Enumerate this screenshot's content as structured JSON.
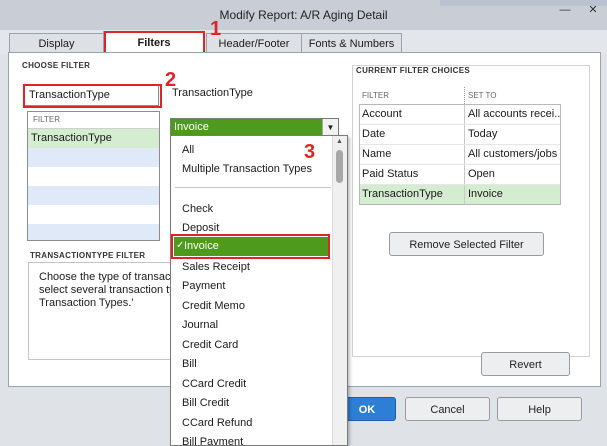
{
  "window": {
    "title": "Modify Report: A/R Aging Detail",
    "controls": {
      "minimize_icon": "minimize-icon",
      "close_icon": "close-icon"
    }
  },
  "tabs": [
    {
      "label": "Display"
    },
    {
      "label": "Filters"
    },
    {
      "label": "Header/Footer"
    },
    {
      "label": "Fonts & Numbers"
    }
  ],
  "callouts": [
    "1",
    "2",
    "3"
  ],
  "choose_filter": {
    "title": "CHOOSE FILTER",
    "search_value": "TransactionType",
    "list_header": "FILTER",
    "list_items": [
      "TransactionType"
    ]
  },
  "filter_detail": {
    "label": "TransactionType",
    "selected": "Invoice",
    "options": [
      "All",
      "Multiple Transaction Types",
      "Check",
      "Deposit",
      "Invoice",
      "Sales Receipt",
      "Payment",
      "Credit Memo",
      "Journal",
      "Credit Card",
      "Bill",
      "CCard Credit",
      "Bill Credit",
      "CCard Refund",
      "Bill Payment"
    ]
  },
  "transactiontype_filter": {
    "title": "TRANSACTIONTYPE FILTER",
    "lines": [
      "Choose the type of transacti",
      "select several transaction typ",
      "Transaction Types.'"
    ]
  },
  "current_filter_choices": {
    "title": "CURRENT FILTER CHOICES",
    "col_filter": "FILTER",
    "col_set_to": "SET TO",
    "rows": [
      {
        "filter": "Account",
        "set_to": "All accounts recei..."
      },
      {
        "filter": "Date",
        "set_to": "Today"
      },
      {
        "filter": "Name",
        "set_to": "All customers/jobs"
      },
      {
        "filter": "Paid Status",
        "set_to": "Open"
      },
      {
        "filter": "TransactionType",
        "set_to": "Invoice"
      }
    ]
  },
  "buttons": {
    "remove_selected_filter": "Remove Selected Filter",
    "revert": "Revert",
    "ok": "OK",
    "cancel": "Cancel",
    "help": "Help"
  },
  "colors": {
    "accent_green": "#4d9a1c",
    "selected_row": "#d4ecd0",
    "callout_red": "#e02424",
    "ok_blue": "#2d7fd6"
  }
}
